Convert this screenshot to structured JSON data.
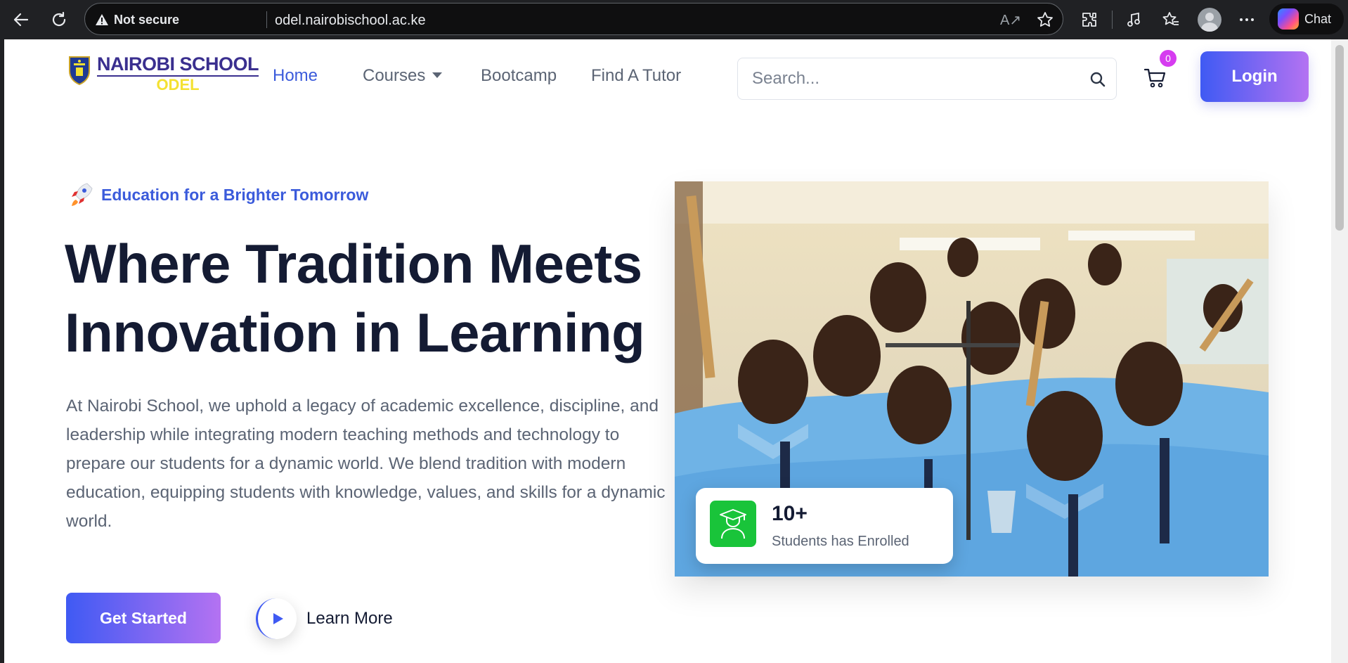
{
  "browser": {
    "security_label": "Not secure",
    "url": "odel.nairobischool.ac.ke",
    "read_aloud_icon": "A↗",
    "chat_label": "Chat"
  },
  "header": {
    "logo": {
      "name": "NAIROBI SCHOOL",
      "sub": "ODEL"
    },
    "nav": {
      "home": "Home",
      "courses": "Courses",
      "bootcamp": "Bootcamp",
      "tutor": "Find A Tutor"
    },
    "search_placeholder": "Search...",
    "cart_count": "0",
    "login_label": "Login"
  },
  "hero": {
    "tagline": "Education for a Brighter Tomorrow",
    "title_line1": "Where Tradition Meets",
    "title_line2": "Innovation in Learning",
    "description": "At Nairobi School, we uphold a legacy of academic excellence, discipline, and leadership while integrating modern teaching methods and technology to prepare our students for a dynamic world. We blend tradition with modern education, equipping students with knowledge, values, and skills for a dynamic world.",
    "cta_label": "Get Started",
    "learn_more_label": "Learn More",
    "stat": {
      "value": "10+",
      "label": "Students has Enrolled"
    }
  },
  "colors": {
    "accent": "#3b5bdb",
    "gradient_start": "#3f5af3",
    "gradient_end": "#b472f2",
    "heading": "#141b33",
    "stat_icon_bg": "#19c43a",
    "badge": "#d63cf0"
  }
}
